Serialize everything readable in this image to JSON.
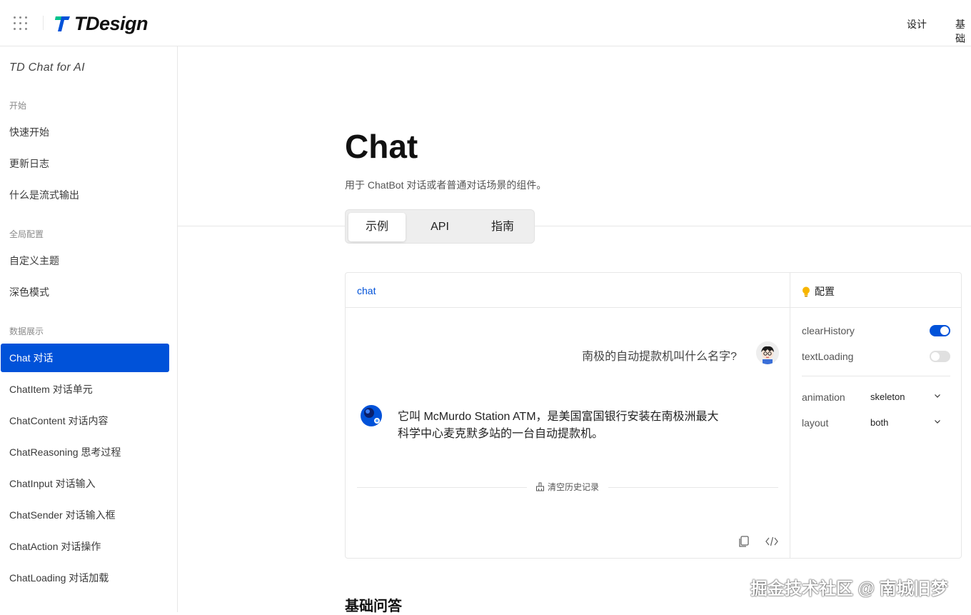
{
  "header": {
    "logo_text": "TDesign",
    "nav": [
      "设计",
      "基础"
    ]
  },
  "sidebar": {
    "title": "TD Chat for AI",
    "groups": [
      {
        "label": "开始",
        "items": [
          "快速开始",
          "更新日志",
          "什么是流式输出"
        ]
      },
      {
        "label": "全局配置",
        "items": [
          "自定义主题",
          "深色模式"
        ]
      },
      {
        "label": "数据展示",
        "items": [
          "Chat 对话",
          "ChatItem 对话单元",
          "ChatContent 对话内容",
          "ChatReasoning 思考过程",
          "ChatInput 对话输入",
          "ChatSender 对话输入框",
          "ChatAction 对话操作",
          "ChatLoading 对话加载"
        ]
      }
    ],
    "active_item": "Chat 对话"
  },
  "main": {
    "title": "Chat",
    "description": "用于 ChatBot 对话或者普通对话场景的组件。",
    "tabs": [
      "示例",
      "API",
      "指南"
    ],
    "active_tab": "示例",
    "section_heading": "基础问答"
  },
  "demo": {
    "tab": "chat",
    "user_message": "南极的自动提款机叫什么名字?",
    "bot_message_line1": "它叫 McMurdo Station ATM，是美国富国银行安装在南极洲最大",
    "bot_message_line2": "科学中心麦克默多站的一台自动提款机。",
    "clear_history": "清空历史记录"
  },
  "config": {
    "title": "配置",
    "clearHistory_label": "clearHistory",
    "clearHistory_on": true,
    "textLoading_label": "textLoading",
    "textLoading_on": false,
    "animation_label": "animation",
    "animation_value": "skeleton",
    "layout_label": "layout",
    "layout_value": "both"
  },
  "watermark": "掘金技术社区 @ 南城旧梦",
  "colors": {
    "brand": "#0052d9",
    "toggle_off": "#e0e0e0"
  }
}
